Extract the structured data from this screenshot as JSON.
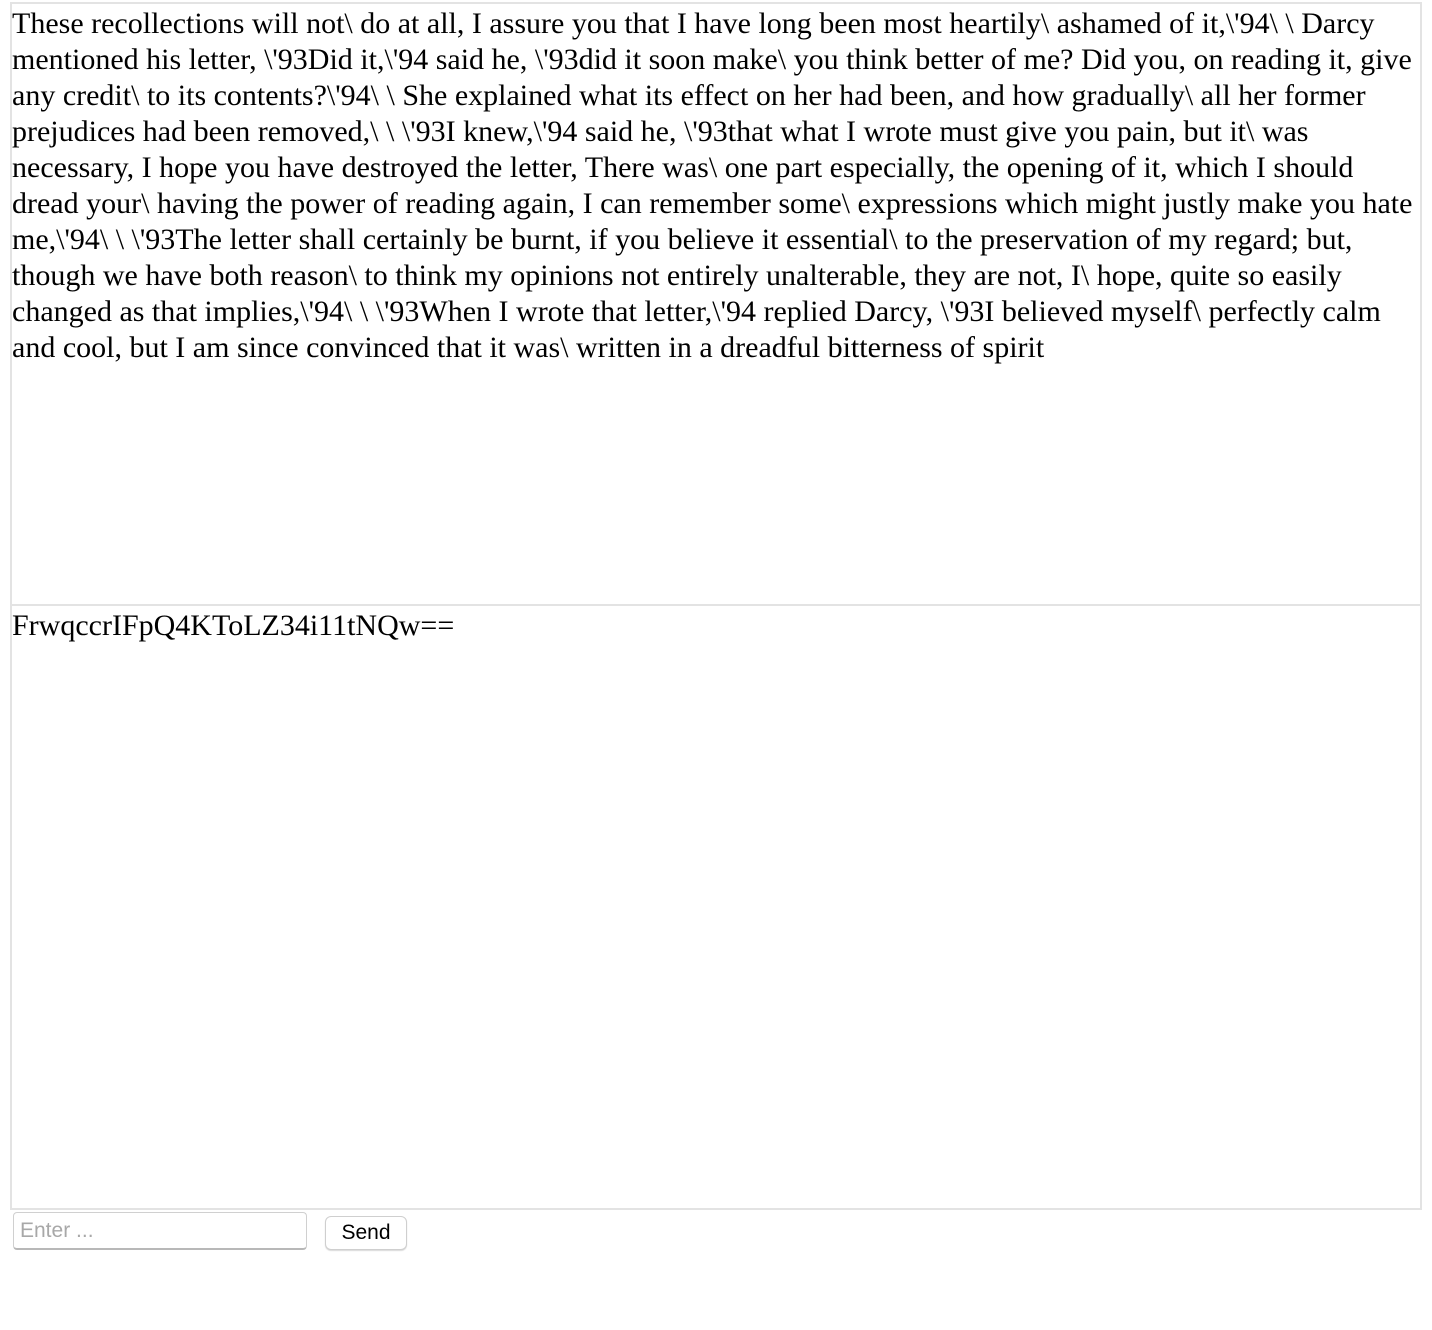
{
  "panels": {
    "top": {
      "text": "These recollections will not\\ do at all, I assure you that I have long been most heartily\\ ashamed of it,\\'94\\ \\ Darcy mentioned his letter, \\'93Did it,\\'94 said he, \\'93did it soon make\\ you think better of me? Did you, on reading it, give any credit\\ to its contents?\\'94\\ \\ She explained what its effect on her had been, and how gradually\\ all her former prejudices had been removed,\\ \\ \\'93I knew,\\'94 said he, \\'93that what I wrote must give you pain, but it\\ was necessary, I hope you have destroyed the letter, There was\\ one part especially, the opening of it, which I should dread your\\ having the power of reading again, I can remember some\\ expressions which might justly make you hate me,\\'94\\ \\ \\'93The letter shall certainly be burnt, if you believe it essential\\ to the preservation of my regard; but, though we have both reason\\ to think my opinions not entirely unalterable, they are not, I\\ hope, quite so easily changed as that implies,\\'94\\ \\ \\'93When I wrote that letter,\\'94 replied Darcy, \\'93I believed myself\\ perfectly calm and cool, but I am since convinced that it was\\ written in a dreadful bitterness of spirit"
    },
    "bottom": {
      "text": "FrwqccrIFpQ4KToLZ34i11tNQw=="
    }
  },
  "composer": {
    "input_value": "",
    "input_placeholder": "Enter ...",
    "send_label": "Send"
  }
}
